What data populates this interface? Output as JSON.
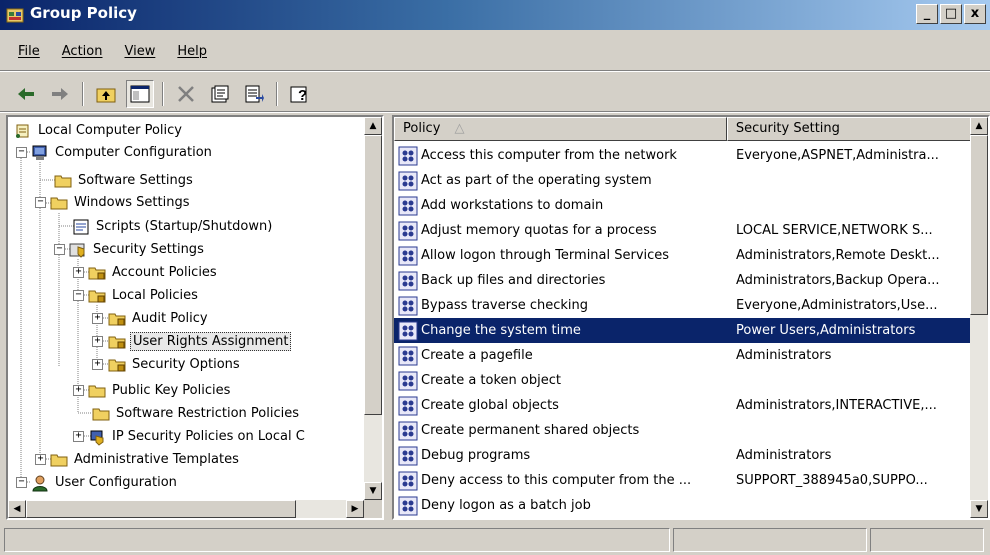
{
  "window": {
    "title": "Group Policy"
  },
  "titlebar_buttons": [
    "_",
    "□",
    "x"
  ],
  "menu": [
    "File",
    "Action",
    "View",
    "Help"
  ],
  "toolbar": [
    "back-arrow-icon",
    "forward-arrow-icon",
    "up-folder-icon",
    "show-hide-tree-icon",
    "delete-icon",
    "properties-icon",
    "export-list-icon",
    "help-icon"
  ],
  "tree": {
    "items": [
      {
        "label": "Local Computer Policy"
      },
      {
        "label": "Computer Configuration"
      },
      {
        "label": "Software Settings"
      },
      {
        "label": "Windows Settings"
      },
      {
        "label": "Scripts (Startup/Shutdown)"
      },
      {
        "label": "Security Settings"
      },
      {
        "label": "Account Policies"
      },
      {
        "label": "Local Policies"
      },
      {
        "label": "Audit Policy"
      },
      {
        "label": "User Rights Assignment"
      },
      {
        "label": "Security Options"
      },
      {
        "label": "Public Key Policies"
      },
      {
        "label": "Software Restriction Policies"
      },
      {
        "label": "IP Security Policies on Local C"
      },
      {
        "label": "Administrative Templates"
      },
      {
        "label": "User Configuration"
      }
    ]
  },
  "list": {
    "columns": [
      "Policy",
      "Security Setting"
    ],
    "rows": [
      {
        "policy": "Access this computer from the network",
        "setting": "Everyone,ASPNET,Administra..."
      },
      {
        "policy": "Act as part of the operating system",
        "setting": ""
      },
      {
        "policy": "Add workstations to domain",
        "setting": ""
      },
      {
        "policy": "Adjust memory quotas for a process",
        "setting": "LOCAL SERVICE,NETWORK S..."
      },
      {
        "policy": "Allow logon through Terminal Services",
        "setting": "Administrators,Remote Deskt..."
      },
      {
        "policy": "Back up files and directories",
        "setting": "Administrators,Backup Opera..."
      },
      {
        "policy": "Bypass traverse checking",
        "setting": "Everyone,Administrators,Use..."
      },
      {
        "policy": "Change the system time",
        "setting": "Power Users,Administrators"
      },
      {
        "policy": "Create a pagefile",
        "setting": "Administrators"
      },
      {
        "policy": "Create a token object",
        "setting": ""
      },
      {
        "policy": "Create global objects",
        "setting": "Administrators,INTERACTIVE,..."
      },
      {
        "policy": "Create permanent shared objects",
        "setting": ""
      },
      {
        "policy": "Debug programs",
        "setting": "Administrators"
      },
      {
        "policy": "Deny access to this computer from the ...",
        "setting": "SUPPORT_388945a0,SUPPO..."
      },
      {
        "policy": "Deny logon as a batch job",
        "setting": ""
      }
    ]
  },
  "colors": {
    "selection": "#0a246a",
    "titlebar": "#0a246a",
    "face": "#d4d0c8"
  }
}
